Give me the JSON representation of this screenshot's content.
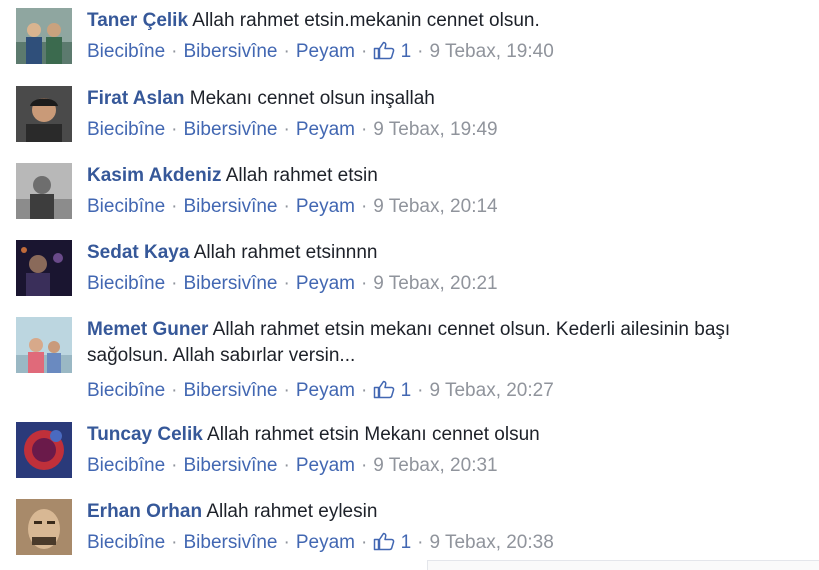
{
  "comments": [
    {
      "author": "Taner Çelik",
      "text": "Allah rahmet etsin.mekanin cennet olsun.",
      "like": "Biecibîne",
      "reply": "Bibersivîne",
      "message": "Peyam",
      "like_count": "1",
      "time": "9 Tebax, 19:40"
    },
    {
      "author": "Firat Aslan",
      "text": "Mekanı cennet olsun inşallah",
      "like": "Biecibîne",
      "reply": "Bibersivîne",
      "message": "Peyam",
      "like_count": "",
      "time": "9 Tebax, 19:49"
    },
    {
      "author": "Kasim Akdeniz",
      "text": "Allah rahmet etsin",
      "like": "Biecibîne",
      "reply": "Bibersivîne",
      "message": "Peyam",
      "like_count": "",
      "time": "9 Tebax, 20:14"
    },
    {
      "author": "Sedat Kaya",
      "text": "Allah rahmet etsinnnn",
      "like": "Biecibîne",
      "reply": "Bibersivîne",
      "message": "Peyam",
      "like_count": "",
      "time": "9 Tebax, 20:21"
    },
    {
      "author": "Memet Guner",
      "text": "Allah rahmet etsin mekanı cennet olsun. Kederli ailesinin başı sağolsun. Allah sabırlar versin...",
      "like": "Biecibîne",
      "reply": "Bibersivîne",
      "message": "Peyam",
      "like_count": "1",
      "time": "9 Tebax, 20:27"
    },
    {
      "author": "Tuncay Celik",
      "text": "Allah rahmet etsin Mekanı cennet olsun",
      "like": "Biecibîne",
      "reply": "Bibersivîne",
      "message": "Peyam",
      "like_count": "",
      "time": "9 Tebax, 20:31"
    },
    {
      "author": "Erhan Orhan",
      "text": "Allah rahmet eylesin",
      "like": "Biecibîne",
      "reply": "Bibersivîne",
      "message": "Peyam",
      "like_count": "1",
      "time": "9 Tebax, 20:38"
    }
  ],
  "colors": {
    "author": "#365899",
    "link": "#4267b2",
    "meta": "#90949c",
    "text": "#1d2129"
  },
  "icons": {
    "like": "thumbs-up-icon",
    "avatar": "profile-photo"
  }
}
